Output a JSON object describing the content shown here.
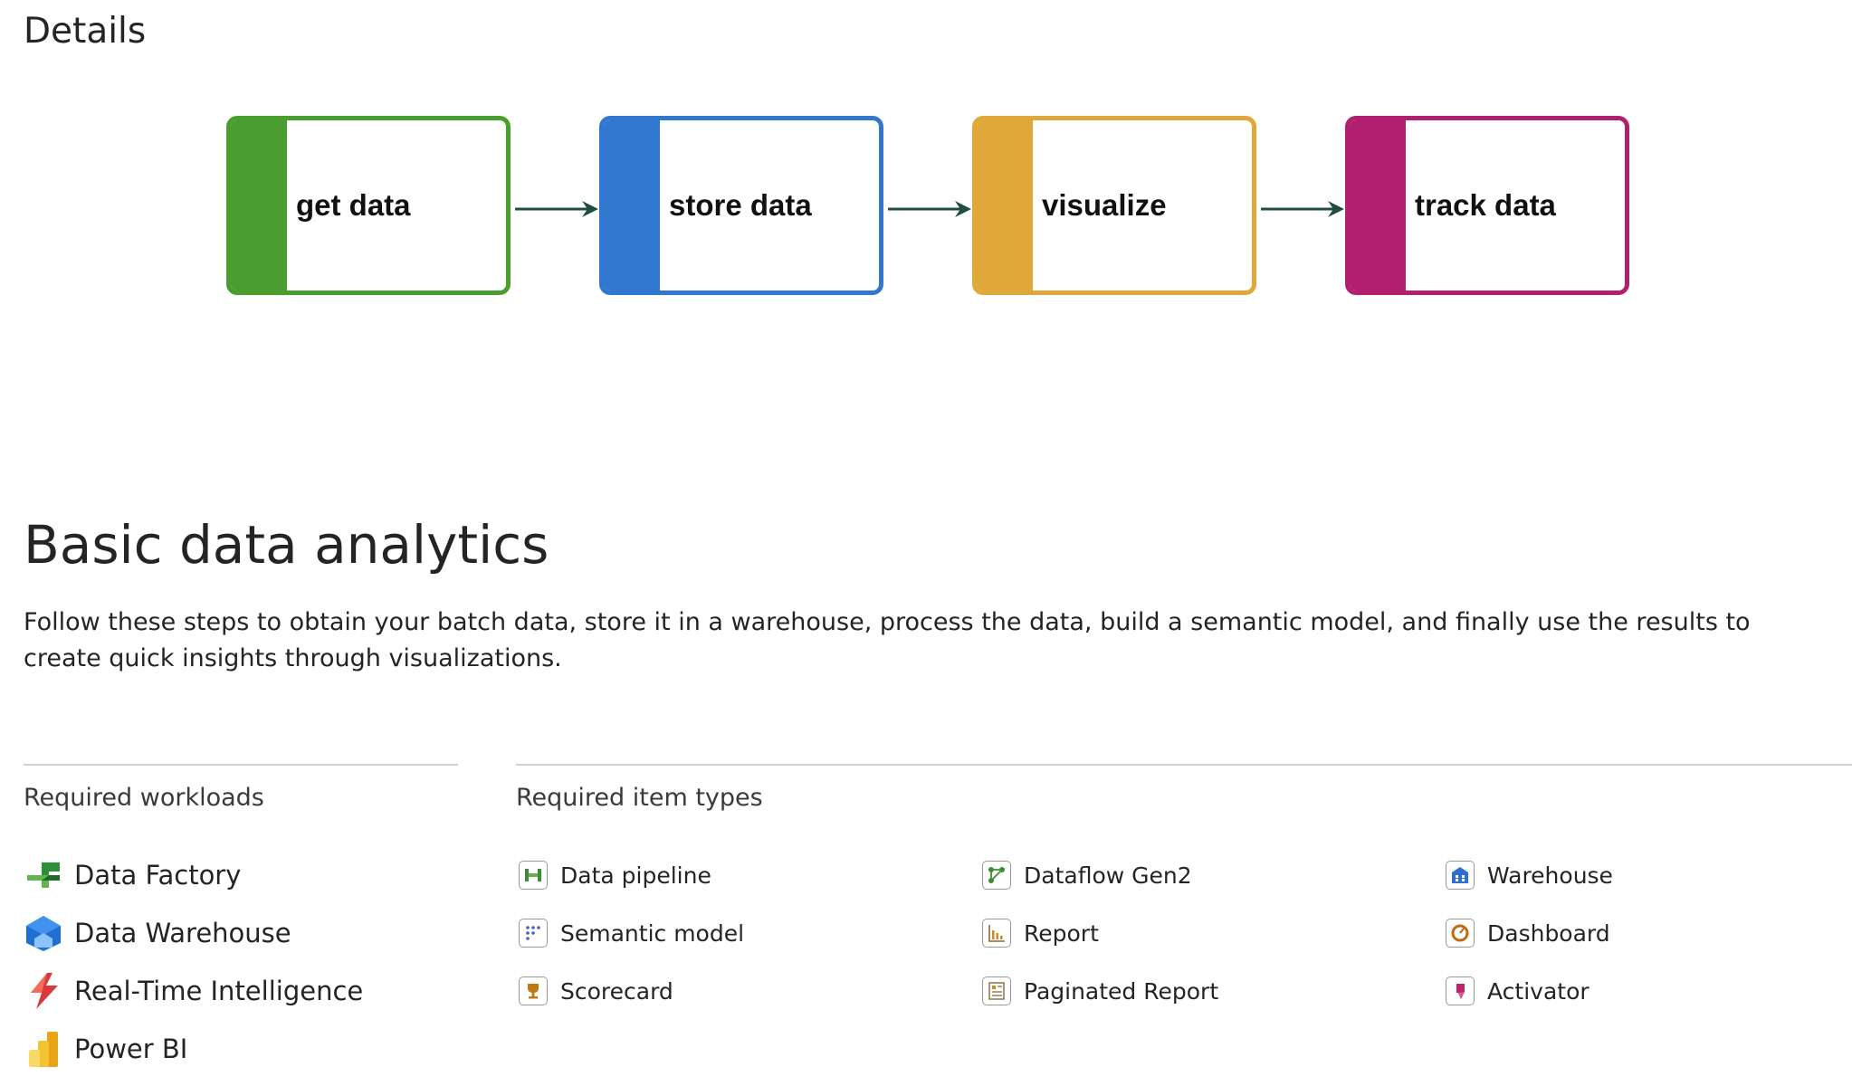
{
  "section_heading": "Details",
  "flow": {
    "steps": [
      {
        "label": "get data",
        "color": "#4a9d2f"
      },
      {
        "label": "store data",
        "color": "#3277cf"
      },
      {
        "label": "visualize",
        "color": "#e0a83a"
      },
      {
        "label": "track data",
        "color": "#b1206f"
      }
    ],
    "arrow_color": "#1f4d3f"
  },
  "title": "Basic data analytics",
  "description": "Follow these steps to obtain your batch data, store it in a warehouse, process the data, build a semantic model, and finally use the results to create quick insights through visualizations.",
  "workloads": {
    "heading": "Required workloads",
    "items": [
      {
        "label": "Data Factory",
        "icon": "data-factory-icon"
      },
      {
        "label": "Data Warehouse",
        "icon": "data-warehouse-icon"
      },
      {
        "label": "Real-Time Intelligence",
        "icon": "real-time-intelligence-icon"
      },
      {
        "label": "Power BI",
        "icon": "power-bi-icon"
      }
    ]
  },
  "item_types": {
    "heading": "Required item types",
    "items": [
      {
        "label": "Data pipeline",
        "icon": "data-pipeline-icon"
      },
      {
        "label": "Dataflow Gen2",
        "icon": "dataflow-gen2-icon"
      },
      {
        "label": "Warehouse",
        "icon": "warehouse-icon"
      },
      {
        "label": "Semantic model",
        "icon": "semantic-model-icon"
      },
      {
        "label": "Report",
        "icon": "report-icon"
      },
      {
        "label": "Dashboard",
        "icon": "dashboard-icon"
      },
      {
        "label": "Scorecard",
        "icon": "scorecard-icon"
      },
      {
        "label": "Paginated Report",
        "icon": "paginated-report-icon"
      },
      {
        "label": "Activator",
        "icon": "activator-icon"
      }
    ]
  }
}
